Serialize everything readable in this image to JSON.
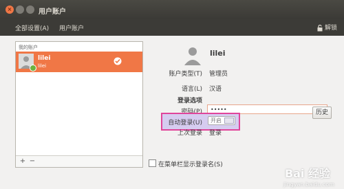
{
  "window": {
    "title": "用户账户"
  },
  "toolbar": {
    "all_settings": "全部设置(A)",
    "current": "用户账户",
    "unlock_label": "解锁"
  },
  "user_list": {
    "header": "我的账户",
    "users": [
      {
        "name": "lilei",
        "subname": "lilei"
      }
    ],
    "add_label": "+",
    "remove_label": "−"
  },
  "profile": {
    "name": "lilei",
    "account_type_label": "账户类型(T)",
    "account_type_value": "管理员",
    "language_label": "语言(L)",
    "language_value": "汉语",
    "login_section": "登录选项",
    "password_label": "密码(P)",
    "password_value": "•••••",
    "autologin_label": "自动登录(U)",
    "autologin_value": "开启",
    "last_login_label": "上次登录",
    "last_login_value": "登录",
    "history_button": "历史"
  },
  "show_login_name_label": "在菜单栏显示登录名(S)",
  "watermark": {
    "main": "Bai 经验",
    "sub": "jingyan.baidu.com"
  }
}
